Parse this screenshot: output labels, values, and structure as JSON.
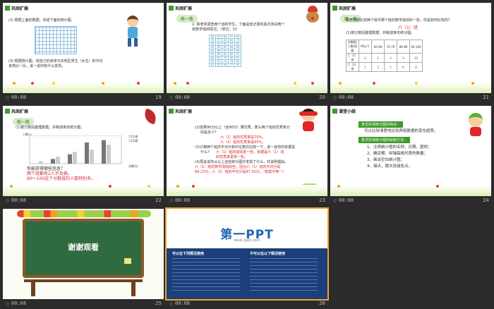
{
  "slides": [
    {
      "number": "19",
      "time": "00:08",
      "section": "巩固扩展",
      "lines": [
        "(2) 根据上面的数据，完成下面的统计图。",
        "(3) 根据统计图，将自己的身高与本地区男生（女生）的平均",
        "身高比一比，说一说你有什么发现。"
      ]
    },
    {
      "number": "20",
      "time": "00:08",
      "section": "巩固扩展",
      "pill": "练一练",
      "lines": [
        "2. 章老师调查两个班的学生，下面是他记录的其次测试两个",
        "班数学成绩情况。（单位：分）"
      ],
      "table_rows": [
        [
          "98",
          "63",
          "88",
          "97",
          "89"
        ],
        [
          "95",
          "97",
          "84",
          "84",
          "79"
        ],
        [
          "89",
          "94",
          "85",
          "93",
          "85"
        ],
        [
          "90",
          "83",
          "87",
          "96",
          "83"
        ],
        [
          "84",
          "86",
          "87",
          "99",
          "86"
        ],
        [
          "99",
          "83",
          "85",
          "89",
          "91"
        ],
        [
          "80",
          "82",
          "78",
          "80",
          "81"
        ],
        [
          "94",
          "93",
          "79",
          "76",
          "93"
        ],
        [
          "87",
          "87",
          "90",
          "77",
          "95"
        ]
      ]
    },
    {
      "number": "21",
      "time": "00:08",
      "section": "巩固扩展",
      "pill": "练一练",
      "lines": [
        "章老师想比较两个班中那个班的数学成绩好一些，你是如何比较的？",
        "(1)按分数段整理数据，并制成条形统计图。"
      ],
      "answer": "六（1）班",
      "head": [
        "分数段/人数/班级",
        "60以下",
        "60-69",
        "70-79",
        "80-89",
        "90-100"
      ],
      "rows": [
        [
          "六（1）班",
          "0",
          "2",
          "4",
          "9",
          "10"
        ],
        [
          "六（2）班",
          "1",
          "3",
          "5",
          "6",
          "8"
        ]
      ]
    },
    {
      "number": "22",
      "time": "00:08",
      "section": "巩固扩展",
      "pill": "练一练",
      "lines": [
        "(1)按分数段整理数据，并制成条形统计图。"
      ],
      "yunit": "人数/人",
      "legend": [
        "六(1)班",
        "六(2)班"
      ],
      "xaxis": "分数/分",
      "q": "你能获得哪些信息？",
      "a1": "两个班都有2人不及格。",
      "a2": "90～100这个分数段的人数特别多。"
    },
    {
      "number": "23",
      "time": "00:08",
      "section": "巩固扩展",
      "lines": [
        "(2)如果90分以上（含90分）算优秀，那么两个班的优秀率分",
        "别是多少?",
        "(3)计算两个班的平均分和中位数并比较一下。说一说你的依据是",
        "什么?",
        "(4)再说说你从以上这些统计图中发现了什么，并说明理由。",
        "六（1）班的数学成绩好些，因为六（1）班的平均分是",
        "89.23分，六（2）班的平均分是87.55分。（答案不唯一）"
      ],
      "ans": [
        "六（1）班的优秀率是70%。",
        "六（2）班的优秀率是65%。",
        "六（1）班的成绩更一些，依据是六（1）班",
        "的优秀率更高一些。"
      ],
      "next": "你说说看"
    },
    {
      "number": "24",
      "time": "00:08",
      "section": "课堂小结",
      "box1": "复式折线统计图的特点：",
      "line1": "可以比较清楚地比较两组数据的变化趋势。",
      "box2": "复式折线统计图的绘制方法：",
      "steps": [
        "1、注明统计图的名称、日期、图例；",
        "2、确定横、纵轴每格代表的数量；",
        "3、画出空白统计图；",
        "4、描点，顺次连接各点。"
      ]
    },
    {
      "number": "25",
      "time": "00:08",
      "board": "谢谢观看"
    },
    {
      "number": "26",
      "time": "00:08",
      "brand": "第一PPT",
      "site": "www.1ppt.com",
      "col1": "可以在下列情况使用",
      "col2": "不可以在以下情况使用"
    }
  ],
  "colors": {
    "accent": "#3d9a2c",
    "selection": "#f1a12c",
    "red": "#d8262a",
    "bg": "#2b2b2b"
  }
}
